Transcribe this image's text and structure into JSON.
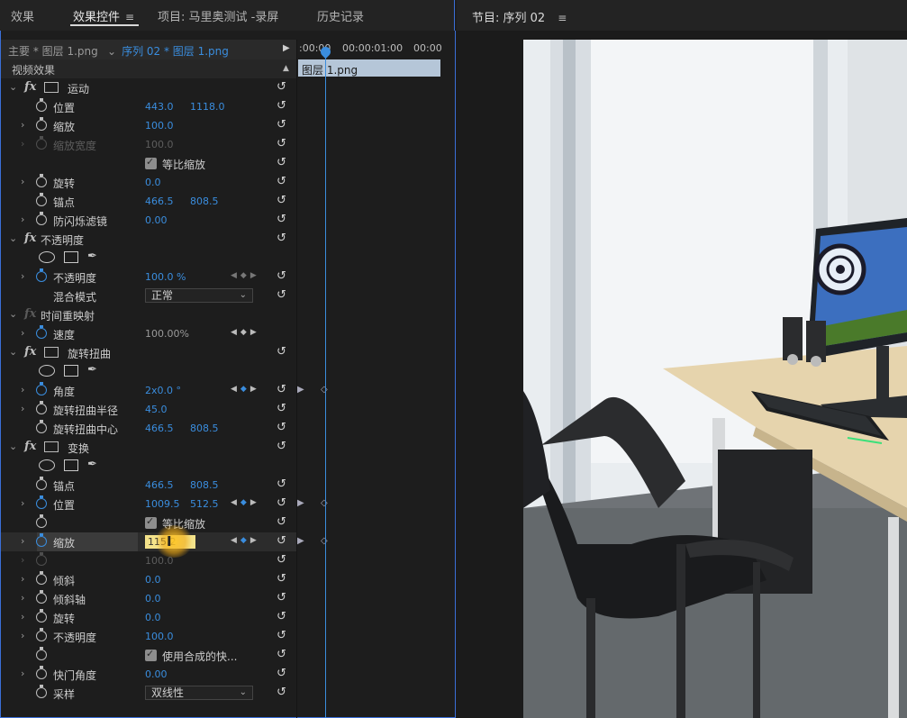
{
  "tabs": [
    {
      "label": "效果"
    },
    {
      "label": "效果控件"
    },
    {
      "label": "项目: 马里奥测试 -录屏"
    },
    {
      "label": "历史记录"
    }
  ],
  "menu_glyph": "≡",
  "source": {
    "master": "主要 * 图层 1.png",
    "sequence": "序列 02 * 图层 1.png"
  },
  "timeline": {
    "tc_start": ":00:00",
    "tc_mid": "00:00:01:00",
    "tc_end": "00:00",
    "clip": "图层 1.png"
  },
  "section_header": "视频效果",
  "effects": {
    "motion": {
      "name": "运动",
      "position": {
        "label": "位置",
        "x": "443.0",
        "y": "1118.0"
      },
      "scale": {
        "label": "缩放",
        "value": "100.0"
      },
      "scale_width": {
        "label": "缩放宽度",
        "value": "100.0"
      },
      "uniform": {
        "label": "等比缩放"
      },
      "rotation": {
        "label": "旋转",
        "value": "0.0"
      },
      "anchor": {
        "label": "锚点",
        "x": "466.5",
        "y": "808.5"
      },
      "flicker": {
        "label": "防闪烁滤镜",
        "value": "0.00"
      }
    },
    "opacity": {
      "name": "不透明度",
      "opacity": {
        "label": "不透明度",
        "value": "100.0 %"
      },
      "blend": {
        "label": "混合模式",
        "value": "正常"
      }
    },
    "time_remap": {
      "name": "时间重映射",
      "speed": {
        "label": "速度",
        "value": "100.00%"
      }
    },
    "twirl": {
      "name": "旋转扭曲",
      "angle": {
        "label": "角度",
        "value": "2x0.0 °"
      },
      "radius": {
        "label": "旋转扭曲半径",
        "value": "45.0"
      },
      "center": {
        "label": "旋转扭曲中心",
        "x": "466.5",
        "y": "808.5"
      }
    },
    "transform": {
      "name": "变换",
      "anchor": {
        "label": "锚点",
        "x": "466.5",
        "y": "808.5"
      },
      "position": {
        "label": "位置",
        "x": "1009.5",
        "y": "512.5"
      },
      "uniform": {
        "label": "等比缩放"
      },
      "scale": {
        "label": "缩放",
        "value": "115.2"
      },
      "scale_width": {
        "value": "100.0"
      },
      "skew": {
        "label": "倾斜",
        "value": "0.0"
      },
      "skew_axis": {
        "label": "倾斜轴",
        "value": "0.0"
      },
      "rotation": {
        "label": "旋转",
        "value": "0.0"
      },
      "opacity": {
        "label": "不透明度",
        "value": "100.0"
      },
      "comp_shutter": {
        "label": "使用合成的快..."
      },
      "shutter_angle": {
        "label": "快门角度",
        "value": "0.00"
      },
      "sampling": {
        "label": "采样",
        "value": "双线性"
      }
    }
  },
  "program": {
    "title": "节目: 序列 02"
  },
  "icons": {
    "reset": "reset-icon",
    "stopwatch": "stopwatch-icon",
    "fx": "fx-icon"
  }
}
